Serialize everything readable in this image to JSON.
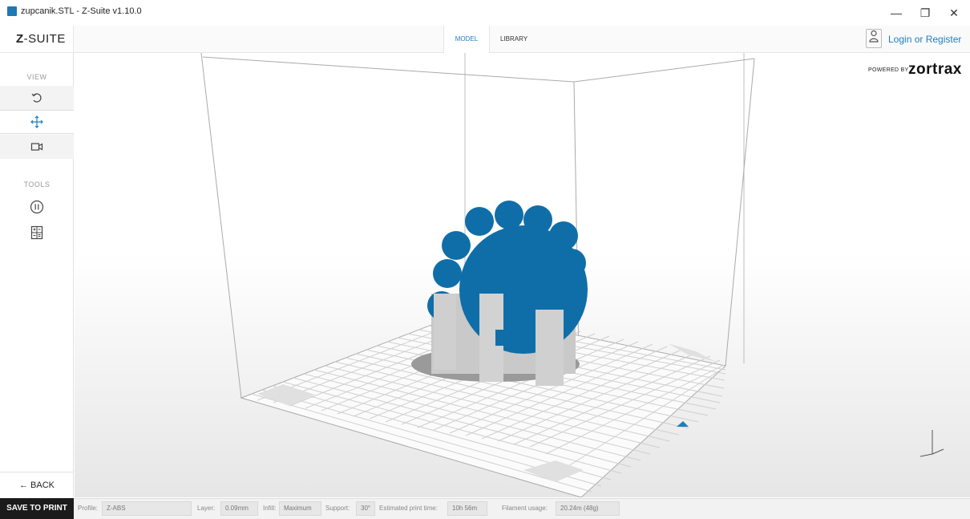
{
  "window": {
    "title": "zupcanik.STL - Z-Suite v1.10.0",
    "minimize_glyph": "—",
    "maximize_glyph": "❐",
    "close_glyph": "✕"
  },
  "header": {
    "logo_prefix": "Z",
    "logo_suffix": "-SUITE",
    "tabs": [
      {
        "label": "MODEL"
      },
      {
        "label": "LIBRARY"
      }
    ],
    "login_label": "Login or Register",
    "powered_by": "POWERED BY",
    "brand": "zortrax"
  },
  "sidebar": {
    "view_label": "VIEW",
    "tools_label": "TOOLS",
    "back_label": "← BACK"
  },
  "status": {
    "save_label": "SAVE TO PRINT",
    "profile_label": "Profile:",
    "profile_value": "Z-ABS",
    "layer_label": "Layer:",
    "layer_value": "0.09mm",
    "infill_label": "Infill:",
    "infill_value": "Maximum",
    "support_label": "Support:",
    "support_value": "30°",
    "time_label": "Estimated print time:",
    "time_value": "10h 56m",
    "filament_label": "Filament usage:",
    "filament_value": "20.24m (48g)"
  },
  "colors": {
    "accent": "#1e7fbf",
    "model": "#0f6ea8"
  }
}
